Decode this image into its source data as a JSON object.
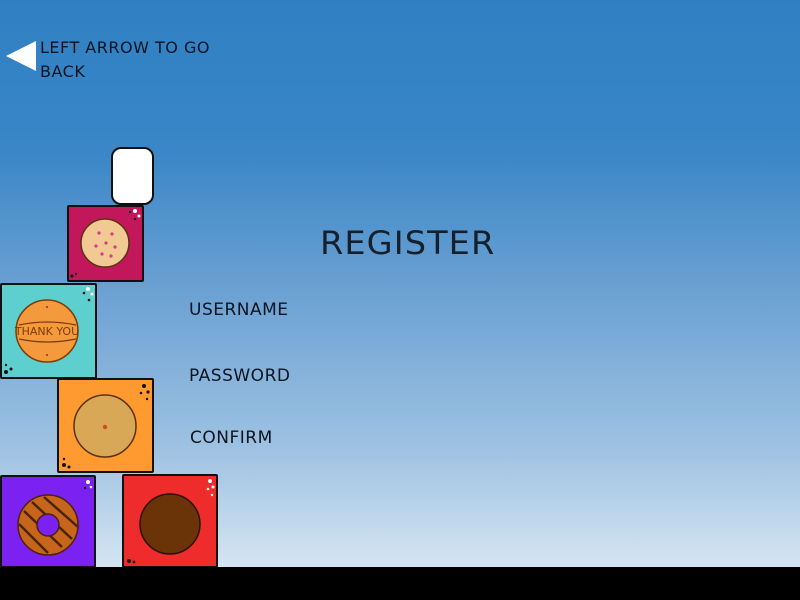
{
  "back_hint": {
    "line1": "LEFT ARROW TO GO",
    "line2": "BACK",
    "icon": "left-triangle-arrow-icon"
  },
  "title": "REGISTER",
  "form": {
    "username_label": "USERNAME",
    "password_label": "PASSWORD",
    "confirm_label": "CONFIRM"
  },
  "cookie_boxes": [
    {
      "name": "pink-box",
      "color": "#c2185b",
      "cookie": "sugar-cookie-with-dots"
    },
    {
      "name": "teal-box",
      "color": "#5ecfcf",
      "cookie": "thank-you-cookie",
      "cookie_text": "THANK YOU"
    },
    {
      "name": "orange-box",
      "color": "#ff9a30",
      "cookie": "plain-cookie"
    },
    {
      "name": "purple-box",
      "color": "#7b22f2",
      "cookie": "striped-donut-cookie"
    },
    {
      "name": "red-box",
      "color": "#ef2c2c",
      "cookie": "chocolate-cookie"
    }
  ],
  "colors": {
    "sky_top": "#2f80c3",
    "sky_bottom": "#d3e4f2",
    "ground": "#000000",
    "text": "#16202c"
  }
}
